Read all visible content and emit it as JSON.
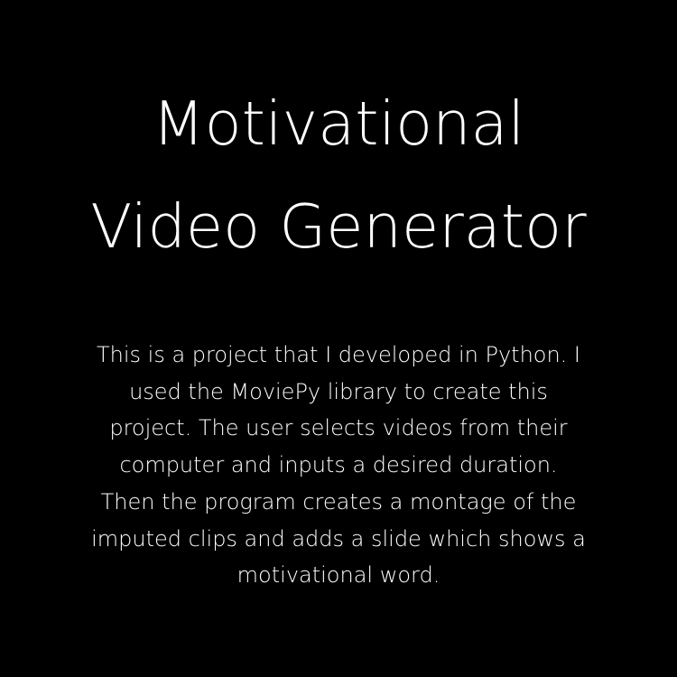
{
  "title": {
    "line1": "Motivational",
    "line2": "Video Generator"
  },
  "description": {
    "lines": [
      "This is a project that I developed in Python.  I",
      "used the MoviePy library to create this",
      "project.  The user selects videos from their",
      "computer and inputs a desired duration.",
      " Then the program creates a montage of the",
      "imputed clips and adds a slide which shows a",
      "motivational word."
    ]
  },
  "colors": {
    "background": "#000000",
    "text": "#ffffff"
  }
}
